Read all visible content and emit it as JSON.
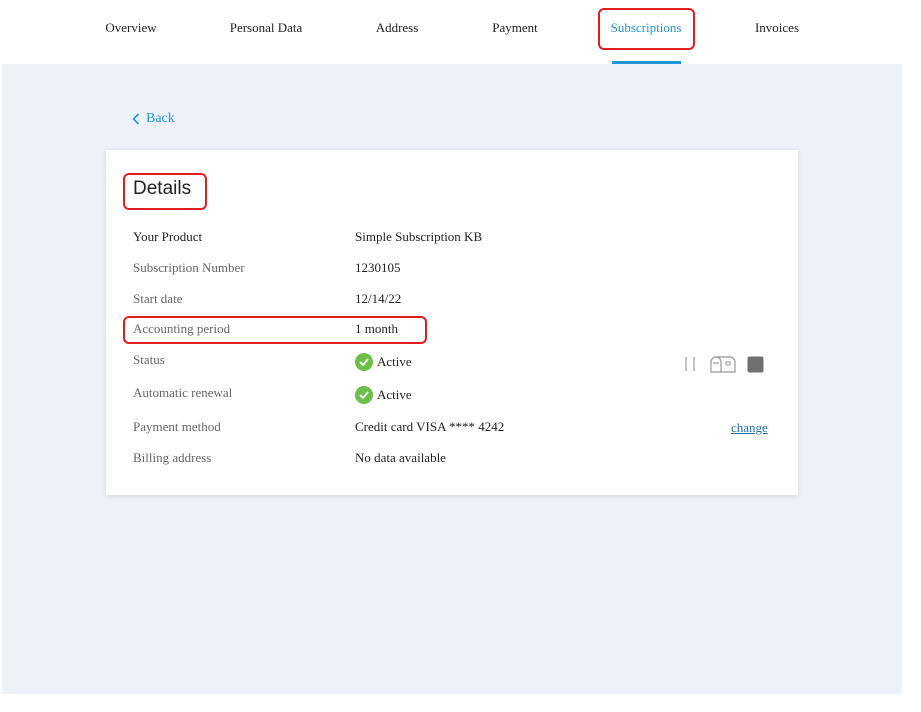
{
  "nav": {
    "tabs": [
      {
        "label": "Overview"
      },
      {
        "label": "Personal Data"
      },
      {
        "label": "Address"
      },
      {
        "label": "Payment"
      },
      {
        "label": "Subscriptions"
      },
      {
        "label": "Invoices"
      }
    ],
    "active_tab": "Subscriptions",
    "accent_color": "#1e96d9"
  },
  "back_label": "Back",
  "details": {
    "title": "Details",
    "rows": [
      {
        "label": "Your Product",
        "value": "Simple Subscription KB"
      },
      {
        "label": "Subscription Number",
        "value": "1230105"
      },
      {
        "label": "Start date",
        "value": "12/14/22"
      },
      {
        "label": "Accounting period",
        "value": "1 month"
      },
      {
        "label": "Status",
        "value": "Active",
        "icon": "check-circle-icon"
      },
      {
        "label": "Automatic renewal",
        "value": "Active",
        "icon": "check-circle-icon"
      },
      {
        "label": "Payment method",
        "value": "Credit card VISA **** 4242"
      },
      {
        "label": "Billing address",
        "value": "No data available"
      }
    ],
    "change_label": "change",
    "status_actions": [
      "pause-icon",
      "mailbox-icon",
      "stop-icon"
    ]
  },
  "highlight_color": "#e01e1e",
  "status_color": "#6cc04a"
}
